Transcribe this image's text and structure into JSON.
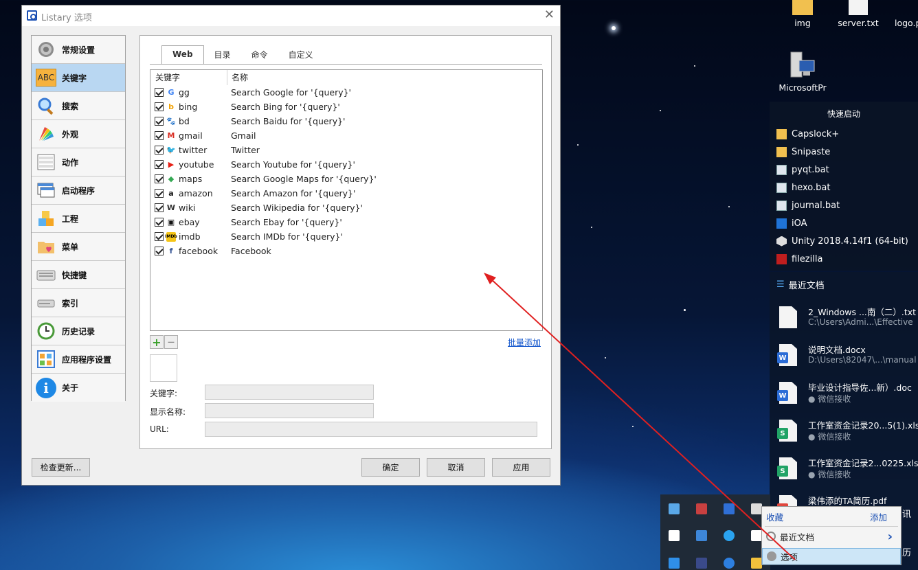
{
  "dialog": {
    "title": "Listary 选项",
    "close_glyph": "✕",
    "sidebar": [
      {
        "label": "常规设置",
        "icon": "gear-icon"
      },
      {
        "label": "关键字",
        "icon": "abc-icon",
        "icon_text": "ABC",
        "active": true
      },
      {
        "label": "搜索",
        "icon": "magnifier-icon"
      },
      {
        "label": "外观",
        "icon": "palette-icon"
      },
      {
        "label": "动作",
        "icon": "actions-icon"
      },
      {
        "label": "启动程序",
        "icon": "windows-icon"
      },
      {
        "label": "工程",
        "icon": "cubes-icon"
      },
      {
        "label": "菜单",
        "icon": "folder-heart-icon"
      },
      {
        "label": "快捷键",
        "icon": "keyboard-icon"
      },
      {
        "label": "索引",
        "icon": "drive-icon"
      },
      {
        "label": "历史记录",
        "icon": "clock-icon"
      },
      {
        "label": "应用程序设置",
        "icon": "app-settings-icon"
      },
      {
        "label": "关于",
        "icon": "info-icon",
        "icon_text": "i"
      }
    ],
    "tabs": [
      "Web",
      "目录",
      "命令",
      "自定义"
    ],
    "grid": {
      "col_keyword": "关键字",
      "col_name": "名称",
      "rows": [
        {
          "keyword": "gg",
          "name": "Search Google for '{query}'",
          "icon": "google-icon",
          "glyph": "G",
          "color": "#4285f4"
        },
        {
          "keyword": "bing",
          "name": "Search Bing for '{query}'",
          "icon": "bing-icon",
          "glyph": "b",
          "color": "#f2a100"
        },
        {
          "keyword": "bd",
          "name": "Search Baidu for '{query}'",
          "icon": "baidu-icon",
          "glyph": "🐾",
          "color": "#2932e1"
        },
        {
          "keyword": "gmail",
          "name": "Gmail",
          "icon": "gmail-icon",
          "glyph": "M",
          "color": "#d93025"
        },
        {
          "keyword": "twitter",
          "name": "Twitter",
          "icon": "twitter-icon",
          "glyph": "🐦",
          "color": "#1da1f2"
        },
        {
          "keyword": "youtube",
          "name": "Search Youtube for '{query}'",
          "icon": "youtube-icon",
          "glyph": "▶",
          "color": "#e62117"
        },
        {
          "keyword": "maps",
          "name": "Search Google Maps for '{query}'",
          "icon": "maps-icon",
          "glyph": "◆",
          "color": "#34a853"
        },
        {
          "keyword": "amazon",
          "name": "Search Amazon for '{query}'",
          "icon": "amazon-icon",
          "glyph": "a",
          "color": "#111111"
        },
        {
          "keyword": "wiki",
          "name": "Search Wikipedia for '{query}'",
          "icon": "wikipedia-icon",
          "glyph": "W",
          "color": "#333333"
        },
        {
          "keyword": "ebay",
          "name": "Search Ebay for '{query}'",
          "icon": "ebay-icon",
          "glyph": "▣",
          "color": "#111111"
        },
        {
          "keyword": "imdb",
          "name": "Search IMDb for '{query}'",
          "icon": "imdb-icon",
          "glyph": "IMDb",
          "color": "#f5c518"
        },
        {
          "keyword": "facebook",
          "name": "Facebook",
          "icon": "facebook-icon",
          "glyph": "f",
          "color": "#3b5998"
        }
      ]
    },
    "add_glyph": "+",
    "remove_glyph": "—",
    "bulk_add": "批量添加",
    "form": {
      "keyword_label": "关键字:",
      "display_name_label": "显示名称:",
      "url_label": "URL:"
    },
    "buttons": {
      "check_update": "检查更新...",
      "ok": "确定",
      "cancel": "取消",
      "apply": "应用"
    }
  },
  "desktop": {
    "icons": [
      {
        "label": "img"
      },
      {
        "label": "server.txt"
      },
      {
        "label": "logo.p"
      },
      {
        "label": "MicrosoftPr"
      }
    ],
    "quick_launch": {
      "title": "快速启动",
      "items": [
        {
          "label": "Capslock+",
          "icon": "folder-icon"
        },
        {
          "label": "Snipaste",
          "icon": "folder-icon"
        },
        {
          "label": "pyqt.bat",
          "icon": "bat-icon"
        },
        {
          "label": "hexo.bat",
          "icon": "bat-icon"
        },
        {
          "label": "journal.bat",
          "icon": "bat-icon"
        },
        {
          "label": "iOA",
          "icon": "ioa-icon"
        },
        {
          "label": "Unity 2018.4.14f1 (64-bit)",
          "icon": "unity-icon"
        },
        {
          "label": "filezilla",
          "icon": "filezilla-icon"
        }
      ]
    },
    "recent": {
      "title": "最近文档",
      "items": [
        {
          "name": "2_Windows ...南（二）.txt",
          "sub": "C:\\Users\\Admi...\\Effective",
          "type": "txt"
        },
        {
          "name": "说明文档.docx",
          "sub": "D:\\Users\\82047\\...\\manual",
          "type": "doc"
        },
        {
          "name": "毕业设计指导佐...新）.doc",
          "sub": "微信接收",
          "type": "doc"
        },
        {
          "name": "工作室资金记录20...5(1).xls",
          "sub": "微信接收",
          "type": "xls"
        },
        {
          "name": "工作室资金记录2...0225.xls",
          "sub": "微信接收",
          "type": "xls"
        },
        {
          "name": "梁伟添的TA简历.pdf",
          "sub": "",
          "type": "pdf"
        }
      ]
    },
    "edge_text": [
      "讯",
      "历"
    ],
    "context_menu": {
      "favorites": "收藏",
      "add": "添加",
      "recent_docs": "最近文档",
      "chevron": "›",
      "options": "选项"
    }
  }
}
